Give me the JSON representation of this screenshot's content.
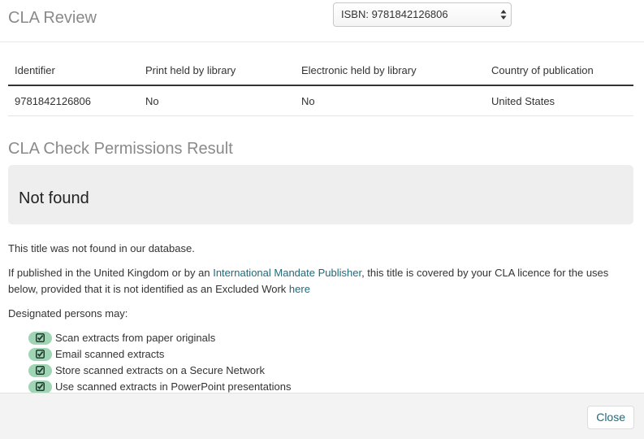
{
  "header": {
    "title": "CLA Review",
    "isbn_select": {
      "selected": "ISBN: 9781842126806"
    }
  },
  "table": {
    "columns": [
      "Identifier",
      "Print held by library",
      "Electronic held by library",
      "Country of publication"
    ],
    "rows": [
      [
        "9781842126806",
        "No",
        "No",
        "United States"
      ]
    ]
  },
  "result": {
    "heading": "CLA Check Permissions Result",
    "status": "Not found"
  },
  "body": {
    "not_found_text": "This title was not found in our database.",
    "coverage_prefix": "If published in the United Kingdom or by an ",
    "imp_link": "International Mandate Publisher",
    "coverage_middle": ", this title is covered by your CLA licence for the uses below, provided that it is not identified as an Excluded Work ",
    "here_link": "here",
    "designated": "Designated persons may:",
    "permissions": [
      "Scan extracts from paper originals",
      "Email scanned extracts",
      "Store scanned extracts on a Secure Network",
      "Use scanned extracts in PowerPoint presentations"
    ]
  },
  "footer": {
    "close_label": "Close"
  },
  "colors": {
    "link": "#1d6b7a",
    "badge": "#9fd4b4",
    "result_box": "#eeeeee"
  },
  "icons": {
    "permission": "checkbox-checked-icon",
    "select": "select-arrows-icon"
  }
}
